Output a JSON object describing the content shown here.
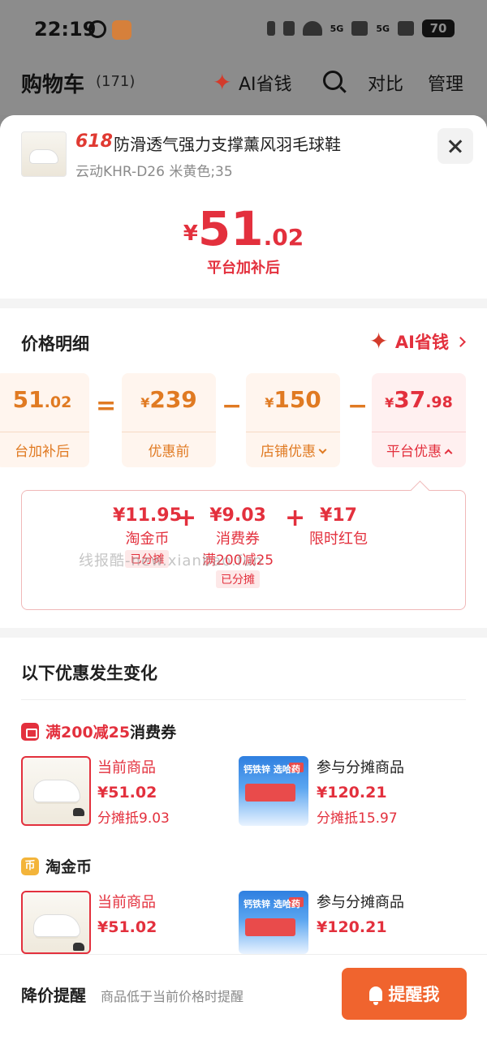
{
  "status_bar": {
    "time": "22:19",
    "battery": "70",
    "net": "5G"
  },
  "header": {
    "title": "购物车",
    "count": "(171)",
    "ai": "AI省钱",
    "compare": "对比",
    "manage": "管理"
  },
  "product": {
    "tag": "618",
    "title": "防滑透气强力支撑薰风羽毛球鞋",
    "sku": "云动KHR-D26 米黄色;35",
    "price_currency": "¥",
    "price_int": "51",
    "price_dec": ".02",
    "price_label": "平台加补后"
  },
  "detail": {
    "title": "价格明细",
    "ai_link": "AI省钱",
    "boxes": [
      {
        "cur": "",
        "int": "51",
        "dec": ".02",
        "label": "台加补后"
      },
      {
        "cur": "¥",
        "int": "239",
        "dec": "",
        "label": "优惠前"
      },
      {
        "cur": "¥",
        "int": "150",
        "dec": "",
        "label": "店铺优惠"
      },
      {
        "cur": "¥",
        "int": "37",
        "dec": ".98",
        "label": "平台优惠"
      }
    ],
    "ops": [
      "=",
      "−",
      "−"
    ],
    "platform_items": [
      {
        "value": "¥11.95",
        "name": "淘金币",
        "note": "",
        "badge": "已分摊"
      },
      {
        "value": "¥9.03",
        "name": "消费券",
        "note": "满200减25",
        "badge": "已分摊"
      },
      {
        "value": "¥17",
        "name": "限时红包",
        "note": "",
        "badge": ""
      }
    ],
    "watermark": "线报酷-new.xianbao.fun"
  },
  "changes": {
    "title": "以下优惠发生变化",
    "sections": [
      {
        "name_red": "满200减25",
        "name_rest": "消费券",
        "current": {
          "label": "当前商品",
          "price": "¥51.02",
          "share": "分摊抵9.03"
        },
        "other": {
          "label": "参与分摊商品",
          "price": "¥120.21",
          "share": "分摊抵15.97"
        }
      },
      {
        "name_red": "",
        "name_rest": "淘金币",
        "current": {
          "label": "当前商品",
          "price": "¥51.02",
          "share": ""
        },
        "other": {
          "label": "参与分摊商品",
          "price": "¥120.21",
          "share": ""
        }
      }
    ],
    "med_banner": "钙铁锌 选哈药"
  },
  "footer": {
    "title": "降价提醒",
    "hint": "商品低于当前价格时提醒",
    "button": "提醒我"
  },
  "colors": {
    "primary_red": "#e3303d",
    "orange": "#e07a22",
    "button": "#f0642e"
  }
}
